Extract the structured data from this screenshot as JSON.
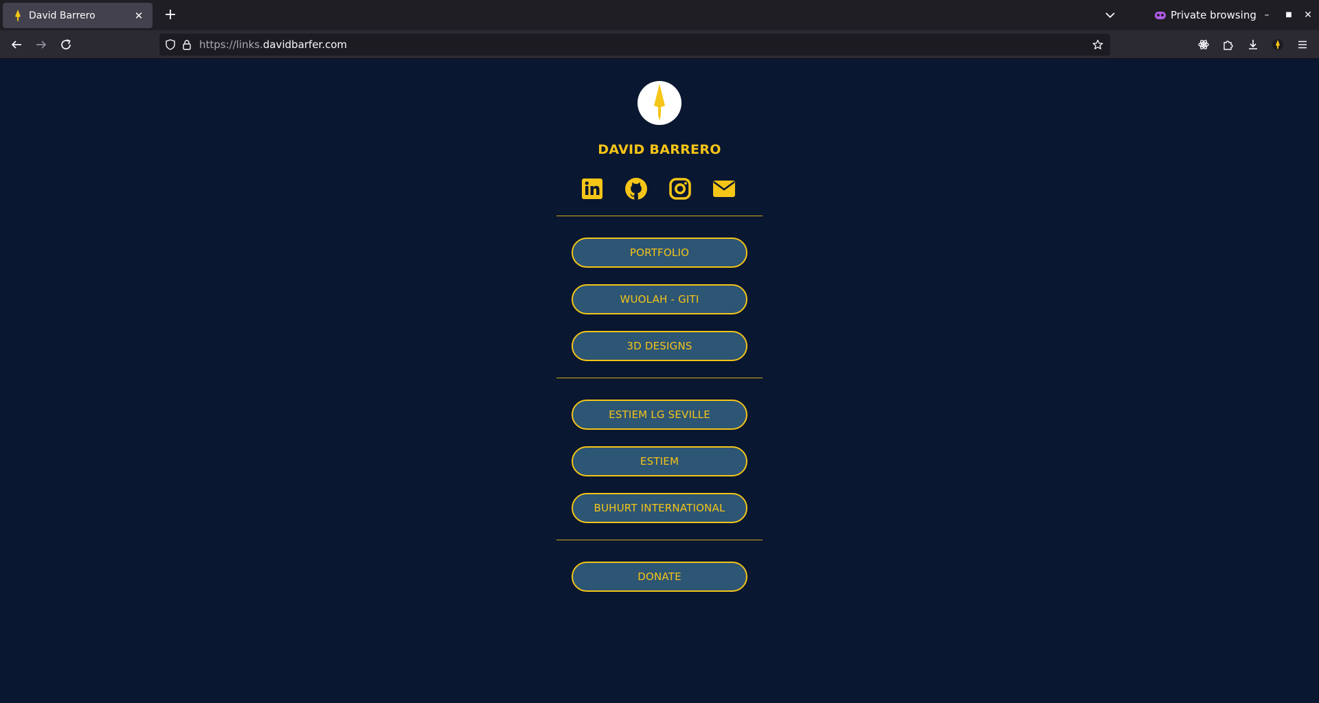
{
  "browser": {
    "tab": {
      "title": "David Barrero",
      "close_icon": "close-icon"
    },
    "new_tab_icon": "plus-icon",
    "private_label": "Private browsing",
    "url": {
      "prefix": "https://links.",
      "domain": "davidbarfer.com"
    },
    "window_controls": [
      "minimize-icon",
      "maximize-icon",
      "close-icon"
    ],
    "toolbar_icons": [
      "back-icon",
      "forward-icon",
      "reload-icon",
      "shield-icon",
      "lock-icon",
      "star-icon",
      "extension-icon",
      "puzzle-icon",
      "download-icon",
      "profile-icon",
      "menu-icon"
    ]
  },
  "profile": {
    "name": "DAVID BARRERO",
    "avatar_icon": "spear-logo",
    "socials": [
      {
        "name": "linkedin-icon"
      },
      {
        "name": "github-icon"
      },
      {
        "name": "instagram-icon"
      },
      {
        "name": "email-icon"
      }
    ]
  },
  "links": {
    "group1": [
      "PORTFOLIO",
      "WUOLAH - GITI",
      "3D DESIGNS"
    ],
    "group2": [
      "ESTIEM LG SEVILLE",
      "ESTIEM",
      "BUHURT INTERNATIONAL"
    ],
    "group3": [
      "DONATE"
    ]
  },
  "colors": {
    "background": "#0a1730",
    "accent": "#f5c518",
    "button_fill": "#2d5574"
  }
}
